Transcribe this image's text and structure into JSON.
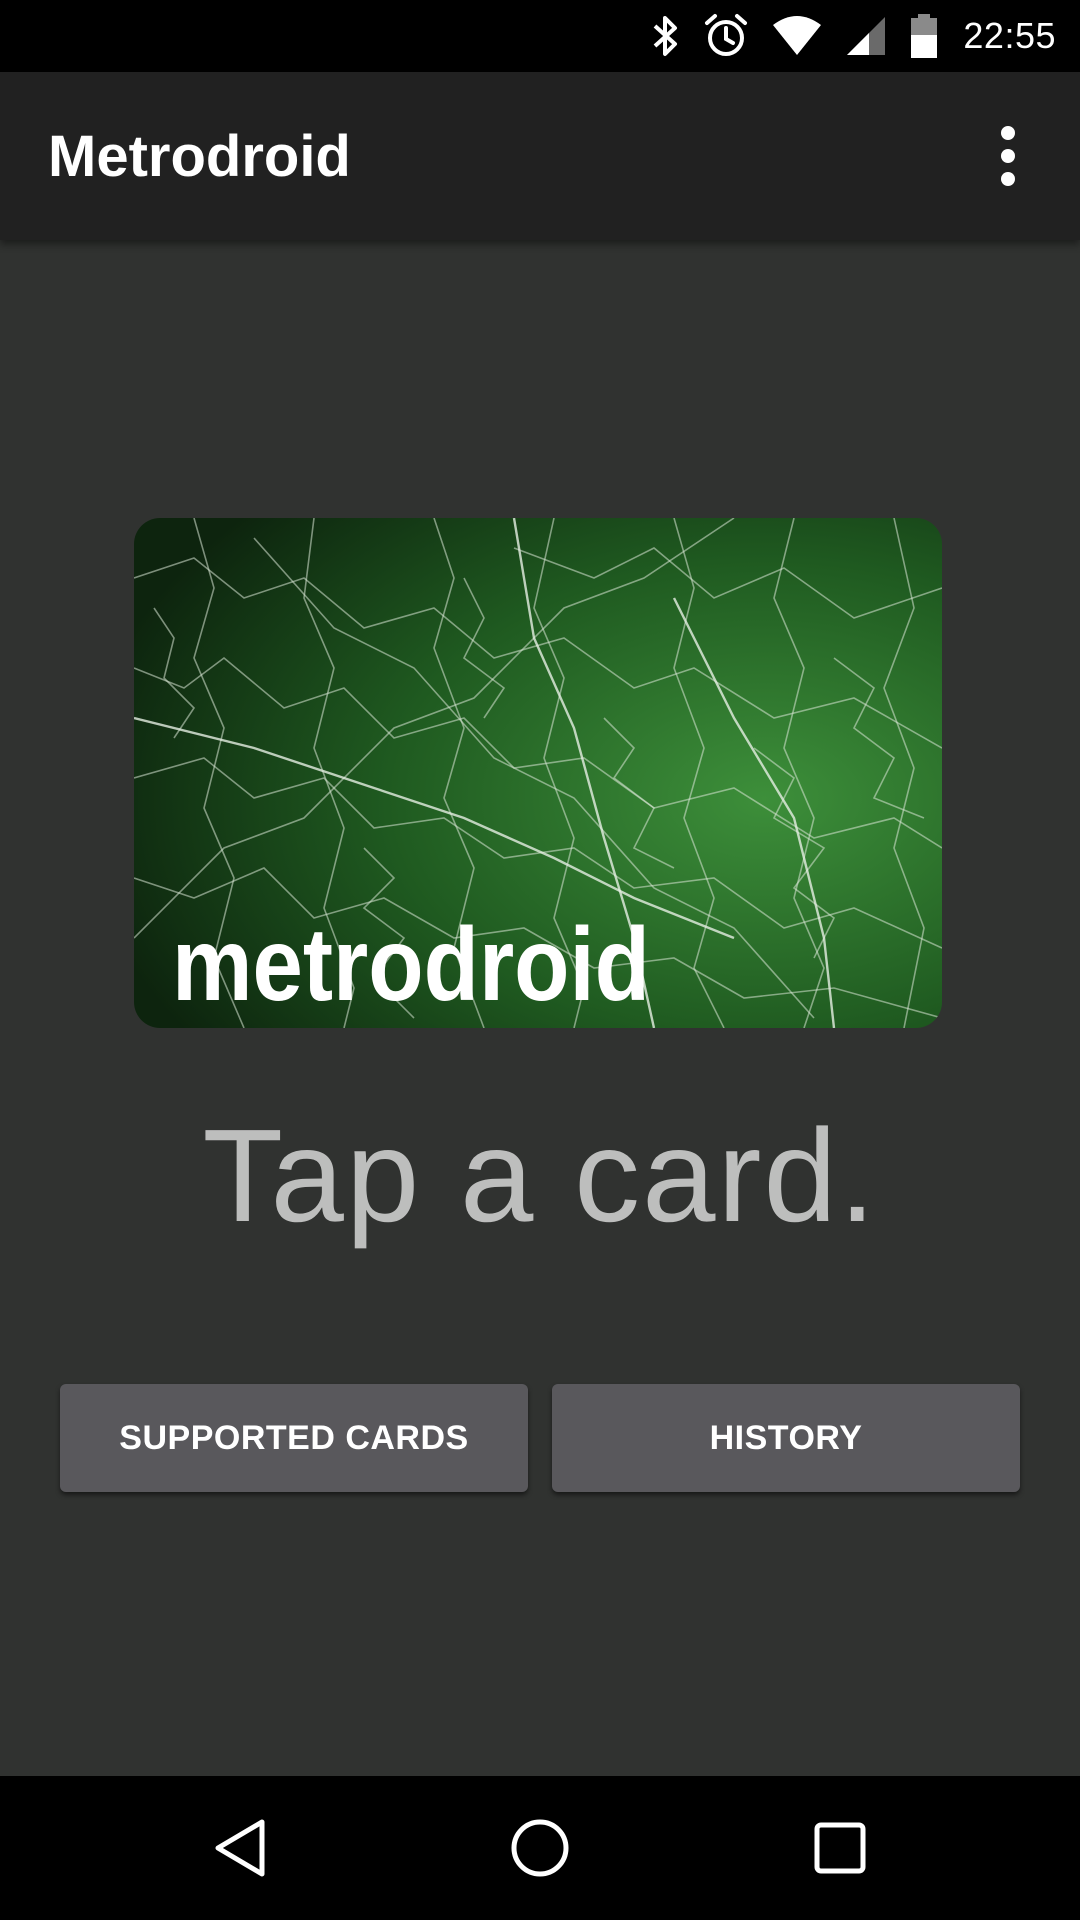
{
  "status_bar": {
    "time": "22:55",
    "icons": [
      "bluetooth-icon",
      "alarm-icon",
      "wifi-icon",
      "cell-signal-icon",
      "battery-icon"
    ]
  },
  "app_bar": {
    "title": "Metrodroid",
    "overflow_icon": "more-vert-icon"
  },
  "card": {
    "logo_text": "metrodroid",
    "colors": {
      "dark": "#0f2a10",
      "light": "#3a8a38"
    }
  },
  "main": {
    "prompt": "Tap a card."
  },
  "buttons": {
    "supported_cards": "SUPPORTED CARDS",
    "history": "HISTORY"
  },
  "nav_bar": {
    "icons": [
      "back-icon",
      "home-icon",
      "recents-icon"
    ]
  },
  "colors": {
    "background": "#303230",
    "app_bar": "#212121",
    "button": "#59585c",
    "prompt_text": "#bdbebd"
  }
}
